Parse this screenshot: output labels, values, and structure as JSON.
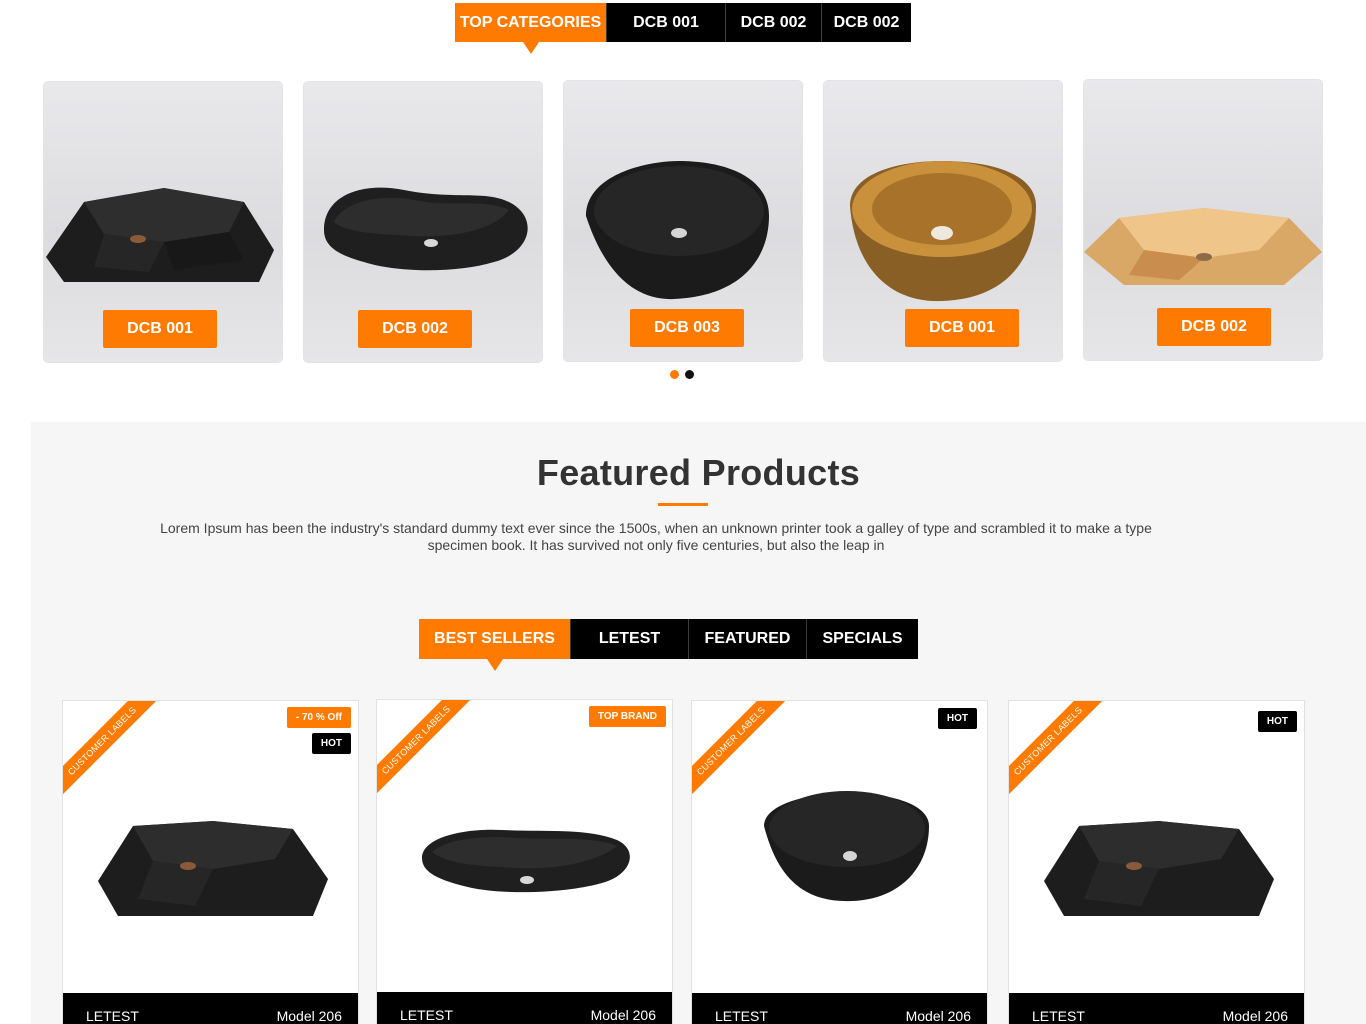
{
  "top_categories": {
    "tabs": [
      "TOP CATEGORIES",
      "DCB 001",
      "DCB 002",
      "DCB 002"
    ],
    "active_index": 0
  },
  "category_cards": [
    {
      "label": "DCB 001",
      "image": "black-faceted-rectangular-basin"
    },
    {
      "label": "DCB 002",
      "image": "black-oval-basin"
    },
    {
      "label": "DCB 003",
      "image": "black-round-bowl-basin"
    },
    {
      "label": "DCB 001",
      "image": "gold-round-bowl-basin"
    },
    {
      "label": "DCB 002",
      "image": "gold-faceted-hexagonal-basin"
    }
  ],
  "carousel": {
    "pages": 2,
    "active_page": 1
  },
  "featured": {
    "title": "Featured Products",
    "description": "Lorem Ipsum has been the industry's standard dummy text ever since the 1500s, when an unknown printer took a galley of type and scrambled it to make a type specimen book. It has survived not only five centuries, but also the leap in"
  },
  "product_tabs": {
    "tabs": [
      "BEST SELLERS",
      "LETEST",
      "FEATURED",
      "SPECIALS"
    ],
    "active_index": 0
  },
  "products": [
    {
      "ribbon": "CUSTOMER LABELS",
      "badges": [
        "- 70 % Off",
        "HOT"
      ],
      "category": "LETEST",
      "name": "Model 206",
      "image": "black-faceted-rectangular-basin"
    },
    {
      "ribbon": "CUSTOMER LABELS",
      "badges": [
        "TOP BRAND"
      ],
      "category": "LETEST",
      "name": "Model 206",
      "image": "black-oval-basin"
    },
    {
      "ribbon": "CUSTOMER LABELS",
      "badges": [
        "HOT"
      ],
      "category": "LETEST",
      "name": "Model 206",
      "image": "black-round-bowl-basin"
    },
    {
      "ribbon": "CUSTOMER LABELS",
      "badges": [
        "HOT"
      ],
      "category": "LETEST",
      "name": "Model 206",
      "image": "black-faceted-rectangular-basin"
    }
  ],
  "colors": {
    "accent": "#ff7a00",
    "dark": "#000000",
    "section_bg": "#f6f6f6"
  }
}
